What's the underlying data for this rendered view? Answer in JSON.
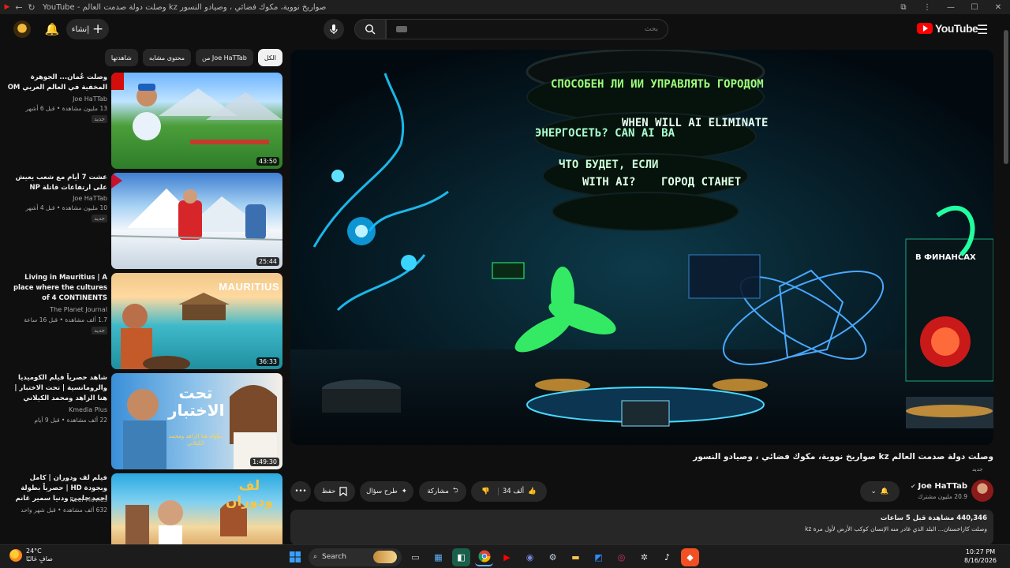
{
  "browser": {
    "title": "YouTube - وصلت دولة صدمت العالم kz صواريخ نووية، مكوك فضائي ، وصيادو النسور"
  },
  "header": {
    "create_label": "إنشاء",
    "search_placeholder": "بحث",
    "logo_text": "YouTube"
  },
  "chips": [
    "الكل",
    "من Joe HaTTab",
    "محتوى مشابه",
    "شاهدتها"
  ],
  "recommendations": [
    {
      "title": "وصلت عُمان... الجوهرة المخفية في العالم العربي OM",
      "channel": "Joe HaTTab",
      "meta": "13 مليون مشاهدة • قبل 6 أشهر",
      "badge": "جديد",
      "duration": "43:50"
    },
    {
      "title": "عشت 7 أيام مع شعب يعيش على ارتفاعات قاتلة NP",
      "channel": "Joe HaTTab",
      "meta": "10 مليون مشاهدة • قبل 4 أشهر",
      "badge": "جديد",
      "duration": "25:44"
    },
    {
      "title": "Living in Mauritius | A place where the cultures of 4 CONTINENTS intersect | 4K ...",
      "channel": "The Planet Journal",
      "meta": "1.7 ألف مشاهدة • قبل 16 ساعة",
      "badge": "جديد",
      "duration": "36:33",
      "thumb_text": "MAURITIUS"
    },
    {
      "title": "شاهد حصرياً فيلم الكوميديا والرومانسية | تحت الاختبار | هنا الزاهد ومحمد الكيلاني FULL HD",
      "channel": "Kmedia Plus",
      "meta": "22 ألف مشاهدة • قبل 9 أيام",
      "badge": "",
      "duration": "1:49:30",
      "thumb_text": "تحت الاختبار",
      "thumb_sub": "بطولة هنا الزاهد ومحمد الكيلاني"
    },
    {
      "title": "فيلم لف ودوران | كامل وبجودة HD | حصرياً بطولة احمد حلمي ودنيا سمير غانم",
      "channel": "Reel Movies",
      "meta": "632 ألف مشاهدة • قبل شهر واحد",
      "badge": "",
      "duration": "",
      "thumb_text": "لف ودوران"
    }
  ],
  "video": {
    "title": "وصلت دولة صدمت العالم kz صواريخ نووية، مكوك فضائي ، وصيادو النسور",
    "badge": "جديد",
    "screen_texts": [
      "СПОСОБЕН ЛИ ИИ УПРАВЛЯТЬ ГОРОДОМ",
      "WHEN WILL AI ELIMINATE",
      "ЧТО БУДЕТ, ЕСЛИ",
      "WITH AI?",
      "ГОРОД СТАНЕТ",
      "ЭНЕРГОСЕТЬ? CAN AI BA",
      "В ФИНАНСАХ"
    ]
  },
  "channel": {
    "name": "Joe HaTTab",
    "subs": "20.9 مليون مشترك"
  },
  "actions": {
    "like_count": "34 ألف",
    "share": "مشاركة",
    "ask": "طرح سؤال",
    "save": "حفظ"
  },
  "description": {
    "line1": "440,346 مشاهدة قبل 5 ساعات",
    "line2": "وصلت كازاخستان... البلد الذي غادر منه الإنسان كوكب الأرض لأول مرة kz"
  },
  "taskbar": {
    "temp": "24°C",
    "weather": "صافٍ غالبًا",
    "search_label": "Search",
    "time": "10:27 PM",
    "date": "8/16/2026"
  },
  "colors": {
    "background": "#0f0f0f",
    "surface": "#272727",
    "brand": "#ff0000"
  }
}
